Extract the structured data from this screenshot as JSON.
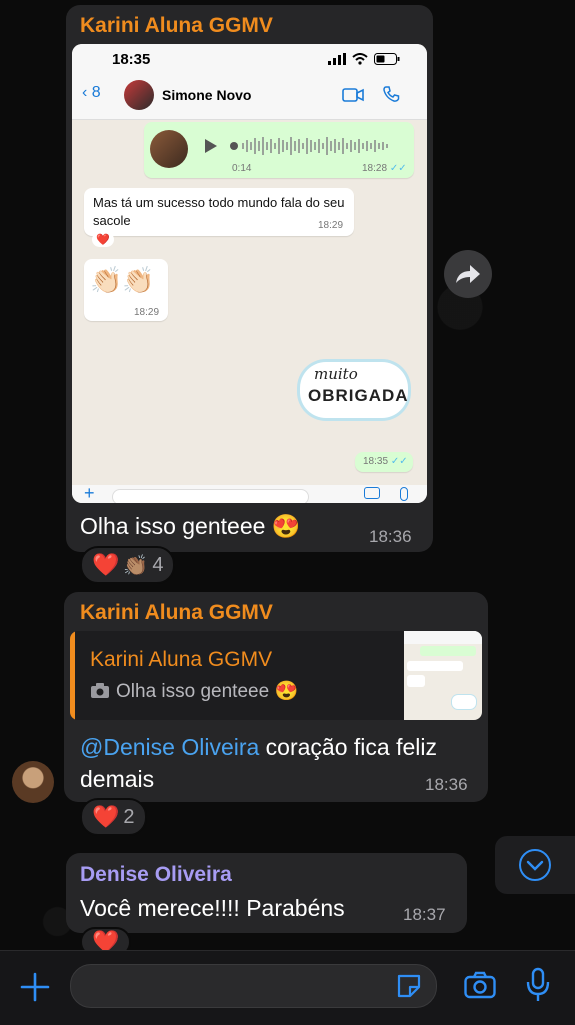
{
  "messages": {
    "m1": {
      "sender": "Karini Aluna GGMV",
      "text": "Olha isso genteee 😍",
      "time": "18:36",
      "reactions": {
        "heart": "❤️",
        "clap": "👏🏽",
        "count": "4"
      },
      "screenshot": {
        "status_time": "18:35",
        "back_count": "8",
        "contact_name": "Simone Novo",
        "voice_duration": "0:14",
        "voice_time": "18:28",
        "text_msg": "Mas tá um sucesso todo mundo fala do seu sacole",
        "text_time": "18:29",
        "text_reaction": "❤️",
        "clap_msg": "👏🏻👏🏻",
        "clap_time": "18:29",
        "sticker_top": "muito",
        "sticker_bottom": "OBRIGADA",
        "sticker_time": "18:35"
      }
    },
    "m2": {
      "sender": "Karini Aluna GGMV",
      "quote_sender": "Karini Aluna GGMV",
      "quote_text": "Olha isso genteee 😍",
      "mention": "@Denise Oliveira",
      "text": " coração fica feliz demais",
      "time": "18:36",
      "reactions": {
        "heart": "❤️",
        "count": "2"
      }
    },
    "m3": {
      "sender": "Denise Oliveira",
      "text": "Você merece!!!! Parabéns",
      "time": "18:37",
      "reactions": {
        "heart": "❤️"
      }
    }
  },
  "colors": {
    "sender_orange": "#f08c1e",
    "sender_purple": "#a79cf3",
    "mention_blue": "#4aa3f0",
    "ios_blue": "#2f8ef5"
  },
  "icons": {
    "forward": "forward-arrow-icon",
    "scroll_down": "chevron-down-circle-icon",
    "attach": "plus-icon",
    "sticker": "sticker-icon",
    "camera": "camera-icon",
    "mic": "microphone-icon"
  }
}
